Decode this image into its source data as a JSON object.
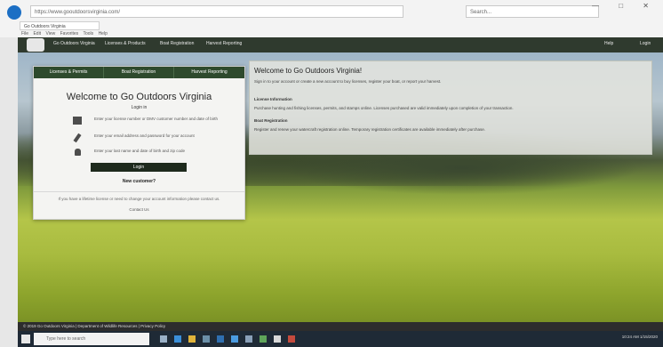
{
  "browser": {
    "address": "https://www.gooutdoorsvirginia.com/",
    "search_placeholder": "Search...",
    "tab_title": "Go Outdoors Virginia",
    "menu": [
      "File",
      "Edit",
      "View",
      "Favorites",
      "Tools",
      "Help"
    ],
    "window_controls": "— □ ✕"
  },
  "navbar": {
    "links": [
      "Go Outdoors Virginia",
      "Licenses & Products",
      "Boat Registration",
      "Harvest Reporting"
    ],
    "right_links": [
      "Help",
      "Login"
    ]
  },
  "login": {
    "tabs": [
      "Licenses & Permits",
      "Boat Registration",
      "Harvest Reporting"
    ],
    "title": "Welcome to Go Outdoors Virginia",
    "login_in": "Login in",
    "options": [
      {
        "icon": "id-card-icon",
        "text": "Enter your license number or DMV customer number and date of birth"
      },
      {
        "icon": "pencil-icon",
        "text": "Enter your email address and password for your account"
      },
      {
        "icon": "user-icon",
        "text": "Enter your last name and date of birth and zip code"
      }
    ],
    "login_button": "Login",
    "need_account": "New customer?",
    "footnote": "If you have a lifetime license or need to change your account information please contact us.",
    "footlink": "Contact Us"
  },
  "info": {
    "title": "Welcome to Go Outdoors Virginia!",
    "subtitle": "Sign in to your account or create a new account to buy licenses, register your boat, or report your harvest.",
    "sections": [
      {
        "head": "License Information",
        "text": "Purchase hunting and fishing licenses, permits, and stamps online. Licenses purchased are valid immediately upon completion of your transaction."
      },
      {
        "head": "Boat Registration",
        "text": "Register and renew your watercraft registration online. Temporary registration certificates are available immediately after purchase."
      }
    ]
  },
  "footer": {
    "text": "© 2019 Go Outdoors Virginia | Department of Wildlife Resources | Privacy Policy"
  },
  "taskbar": {
    "search_placeholder": "Type here to search",
    "tray_text": "10:24 AM  1/15/2020"
  }
}
